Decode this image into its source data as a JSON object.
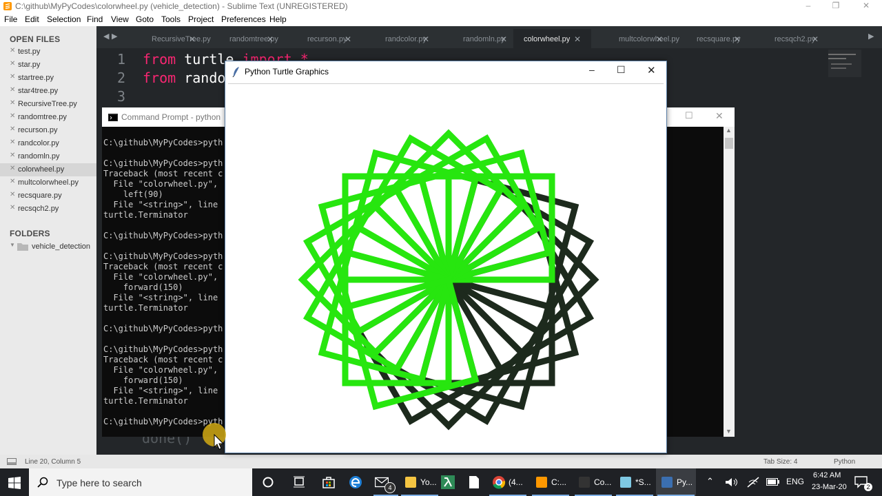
{
  "sublime": {
    "title": "C:\\github\\MyPyCodes\\colorwheel.py (vehicle_detection) - Sublime Text (UNREGISTERED)",
    "menu": [
      "File",
      "Edit",
      "Selection",
      "Find",
      "View",
      "Goto",
      "Tools",
      "Project",
      "Preferences",
      "Help"
    ],
    "sidebar": {
      "open_files_heading": "OPEN FILES",
      "files": [
        "test.py",
        "star.py",
        "startree.py",
        "star4tree.py",
        "RecursiveTree.py",
        "randomtree.py",
        "recurson.py",
        "randcolor.py",
        "randomln.py",
        "colorwheel.py",
        "multcolorwheel.py",
        "recsquare.py",
        "recsqch2.py"
      ],
      "active_index": 9,
      "folders_heading": "FOLDERS",
      "folder": "vehicle_detection"
    },
    "tabs": [
      "RecursiveTree.py",
      "randomtree.py",
      "recurson.py",
      "randcolor.py",
      "randomln.py",
      "colorwheel.py",
      "multcolorwheel.py",
      "recsquare.py",
      "recsqch2.py"
    ],
    "active_tab_index": 5,
    "code": {
      "line_numbers": [
        "1",
        "2",
        "3"
      ],
      "line1_kw": "from",
      "line1_mod": " turtle ",
      "line1_kw2": "import",
      "line1_star": " *",
      "line2_kw": "from",
      "line2_mod": " rando",
      "bottom_partial": "done()"
    },
    "status": {
      "position": "Line 20, Column 5",
      "tab_size": "Tab Size: 4",
      "syntax": "Python"
    }
  },
  "cmd": {
    "title": "Command Prompt - python",
    "lines": [
      "C:\\github\\MyPyCodes>pyth",
      "",
      "C:\\github\\MyPyCodes>pyth",
      "Traceback (most recent c",
      "  File \"colorwheel.py\",",
      "    left(90)",
      "  File \"<string>\", line",
      "turtle.Terminator",
      "",
      "C:\\github\\MyPyCodes>pyth",
      "",
      "C:\\github\\MyPyCodes>pyth",
      "Traceback (most recent c",
      "  File \"colorwheel.py\",",
      "    forward(150)",
      "  File \"<string>\", line",
      "turtle.Terminator",
      "",
      "C:\\github\\MyPyCodes>pyth",
      "",
      "C:\\github\\MyPyCodes>pyth",
      "Traceback (most recent c",
      "  File \"colorwheel.py\",",
      "    forward(150)",
      "  File \"<string>\", line",
      "turtle.Terminator",
      "",
      "C:\\github\\MyPyCodes>pyth"
    ]
  },
  "turtle": {
    "title": "Python Turtle Graphics",
    "drawing": {
      "square_count": 24,
      "green_count": 14,
      "side_length": 150,
      "green_color": "#27e60f",
      "dark_color": "#1d2a1d"
    }
  },
  "taskbar": {
    "search_placeholder": "Type here to search",
    "apps": [
      {
        "icon": "folder-icon",
        "label": "Yo..."
      },
      {
        "icon": "chrome-icon",
        "label": "(4..."
      },
      {
        "icon": "sublime-icon",
        "label": "C:..."
      },
      {
        "icon": "cmd-icon",
        "label": "Co..."
      },
      {
        "icon": "notepad-icon",
        "label": "*S..."
      },
      {
        "icon": "python-icon",
        "label": "Py..."
      }
    ],
    "mail_badge": "4",
    "language": "ENG",
    "time": "6:42 AM",
    "date": "23-Mar-20",
    "notifications": "2"
  }
}
